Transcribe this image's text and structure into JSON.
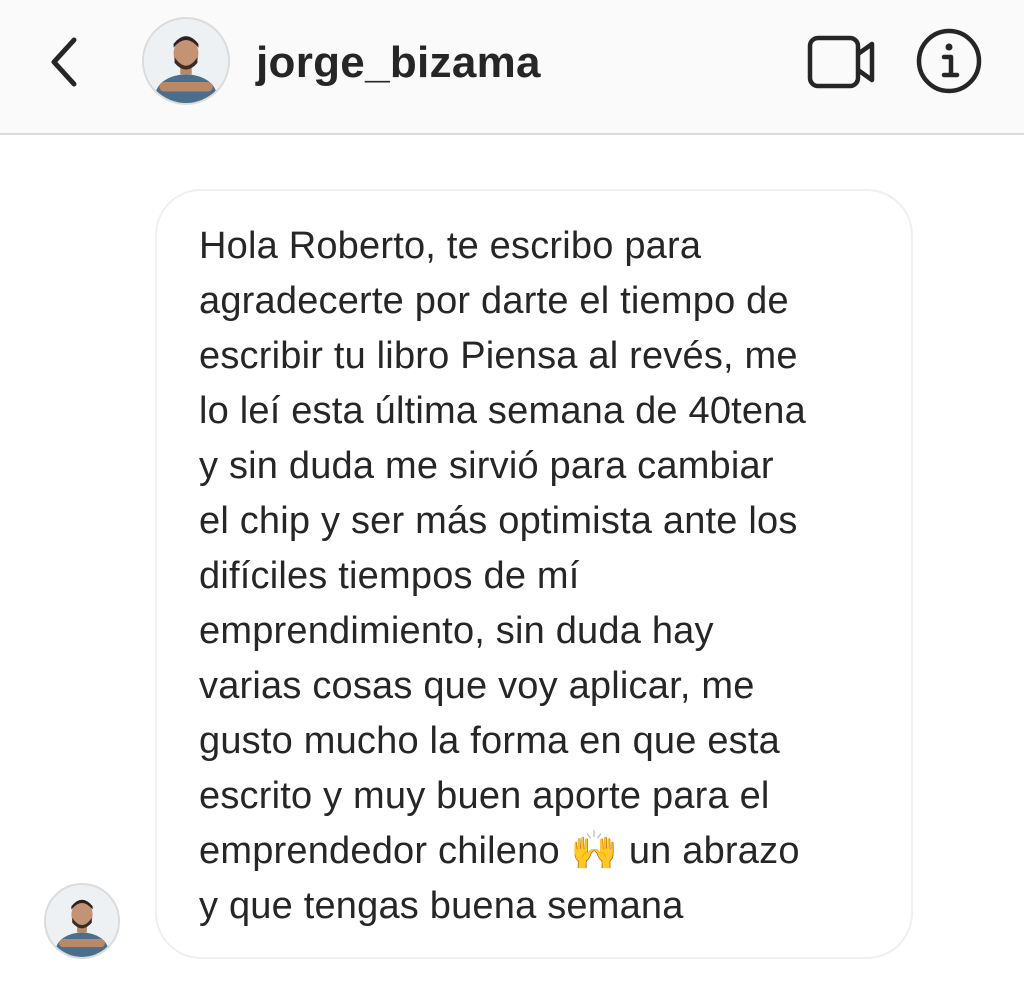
{
  "header": {
    "username": "jorge_bizama",
    "back_icon": "chevron-left-icon",
    "video_icon": "video-camera-icon",
    "info_icon": "info-icon"
  },
  "message": {
    "text": "Hola Roberto, te escribo para\nagradecerte por darte el tiempo de\nescribir tu libro Piensa al revés, me\nlo leí esta última semana de 40tena\ny sin duda me sirvió para cambiar\nel chip y ser más optimista ante los\ndifíciles tiempos de mí\nemprendimiento, sin duda hay\nvarias cosas que voy aplicar, me\ngusto mucho la forma en que esta\nescrito y muy buen aporte para el\nemprendedor chileno 🙌 un abrazo\ny que tengas buena semana"
  },
  "colors": {
    "header_bg": "#fafafa",
    "border": "#dbdbdb",
    "text": "#262626",
    "bubble_border": "#efefef"
  }
}
